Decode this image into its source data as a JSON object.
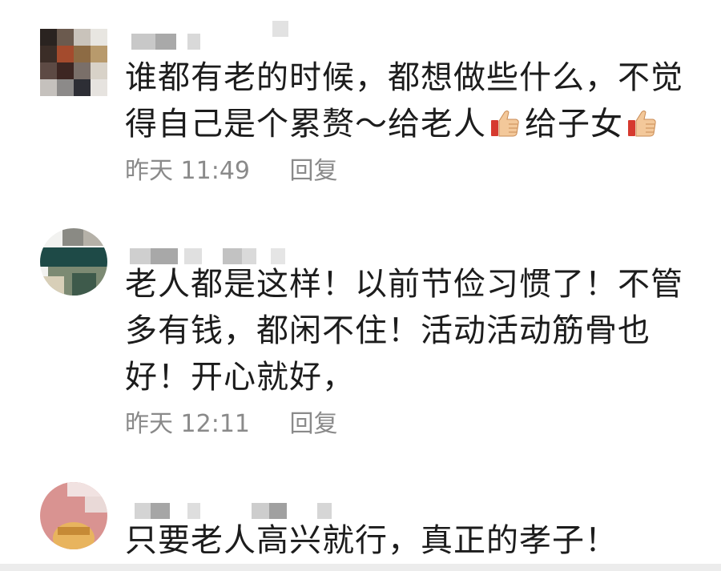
{
  "comments": [
    {
      "text_before": "谁都有老的时候，都想做些什么，不觉得自己是个累赘～给老人",
      "emoji_1": "thumbs-up",
      "text_middle": "给子女",
      "emoji_2": "thumbs-up",
      "time": "昨天 11:49",
      "reply": "回复"
    },
    {
      "text": "老人都是这样！以前节俭习惯了！不管多有钱，都闲不住！活动活动筋骨也好！开心就好，",
      "time": "昨天 12:11",
      "reply": "回复"
    },
    {
      "text": "只要老人高兴就行，真正的孝子！"
    }
  ],
  "colors": {
    "text": "#1c1c1c",
    "meta": "#8a8a8a",
    "divider": "#ececec"
  }
}
